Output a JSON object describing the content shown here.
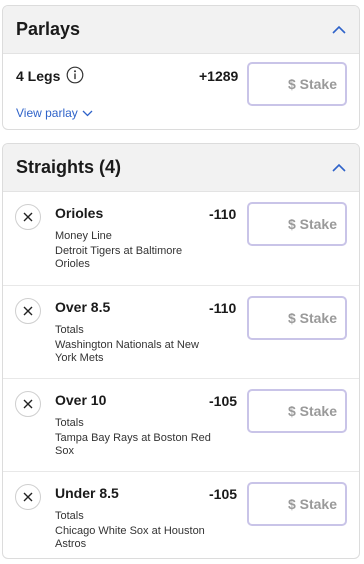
{
  "parlays": {
    "title": "Parlays",
    "legs_label": "4 Legs",
    "odds": "+1289",
    "stake_placeholder": "$ Stake",
    "view_parlay": "View parlay"
  },
  "straights": {
    "title": "Straights (4)",
    "bets": [
      {
        "selection": "Orioles",
        "odds": "-110",
        "market": "Money Line",
        "matchup": "Detroit Tigers at Baltimore Orioles",
        "stake_placeholder": "$ Stake"
      },
      {
        "selection": "Over 8.5",
        "odds": "-110",
        "market": "Totals",
        "matchup": "Washington Nationals at New York Mets",
        "stake_placeholder": "$ Stake"
      },
      {
        "selection": "Over 10",
        "odds": "-105",
        "market": "Totals",
        "matchup": "Tampa Bay Rays at Boston Red Sox",
        "stake_placeholder": "$ Stake"
      },
      {
        "selection": "Under 8.5",
        "odds": "-105",
        "market": "Totals",
        "matchup": "Chicago White Sox at Houston Astros",
        "stake_placeholder": "$ Stake"
      }
    ]
  },
  "colors": {
    "accent": "#2f63c9",
    "stake_border": "#c9c4e8",
    "header_bg": "#f2f2f2"
  },
  "icons": {
    "collapse": "chevron-up-icon",
    "info": "info-icon",
    "expand": "chevron-down-icon",
    "remove": "close-icon"
  }
}
